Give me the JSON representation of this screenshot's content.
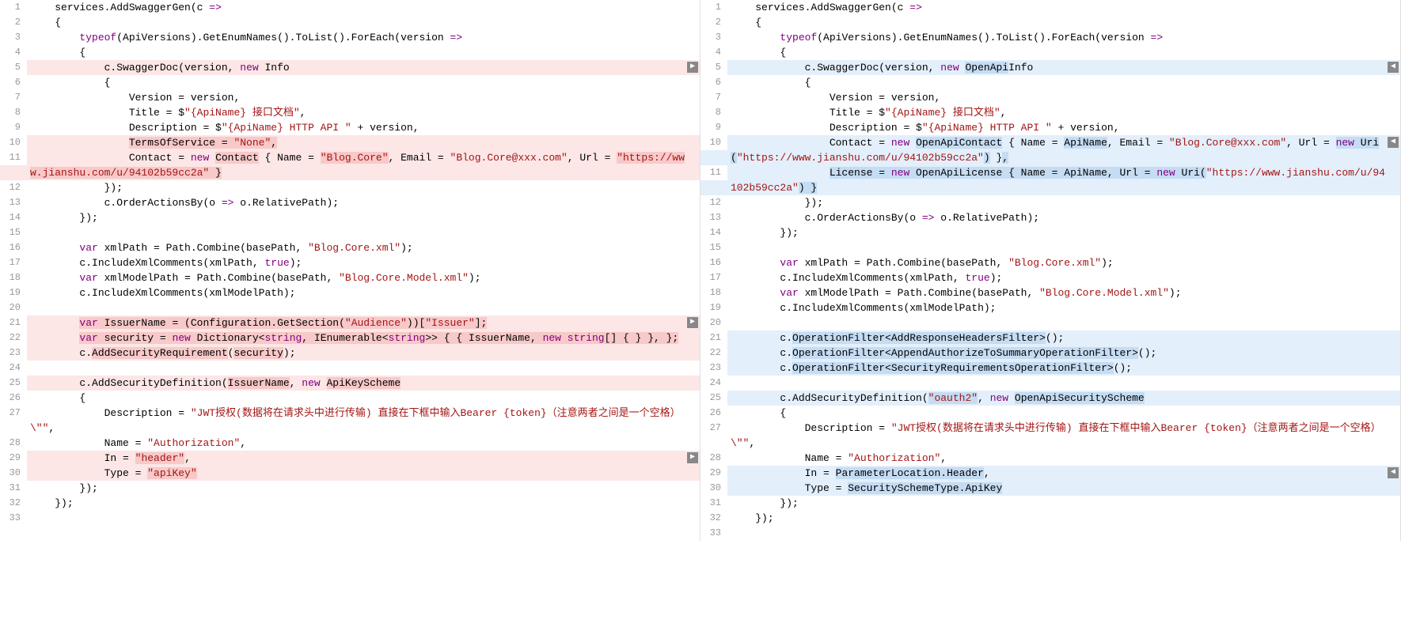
{
  "left": {
    "lines": [
      {
        "num": "1",
        "tokens": [
          [
            "idn",
            "    services.AddSwaggerGen(c "
          ],
          [
            "purple",
            "=>"
          ]
        ]
      },
      {
        "num": "2",
        "tokens": [
          [
            "idn",
            "    {"
          ]
        ]
      },
      {
        "num": "3",
        "tokens": [
          [
            "idn",
            "        "
          ],
          [
            "purple",
            "typeof"
          ],
          [
            "idn",
            "(ApiVersions).GetEnumNames().ToList().ForEach(version "
          ],
          [
            "purple",
            "=>"
          ]
        ]
      },
      {
        "num": "4",
        "tokens": [
          [
            "idn",
            "        {"
          ]
        ]
      },
      {
        "num": "5",
        "bg": "hl-red",
        "marker": true,
        "tokens": [
          [
            "idn",
            "            c.SwaggerDoc(version, "
          ],
          [
            "purple",
            "new"
          ],
          [
            "idn",
            " Info"
          ]
        ]
      },
      {
        "num": "6",
        "tokens": [
          [
            "idn",
            "            {"
          ]
        ]
      },
      {
        "num": "7",
        "tokens": [
          [
            "idn",
            "                Version = version,"
          ]
        ]
      },
      {
        "num": "8",
        "tokens": [
          [
            "idn",
            "                Title = $"
          ],
          [
            "str",
            "\"{ApiName} 接口文档\""
          ],
          [
            "idn",
            ","
          ]
        ]
      },
      {
        "num": "9",
        "tokens": [
          [
            "idn",
            "                Description = $"
          ],
          [
            "str",
            "\"{ApiName} HTTP API \""
          ],
          [
            "idn",
            " + version,"
          ]
        ]
      },
      {
        "num": "10",
        "bg": "hl-red",
        "tokens": [
          [
            "idn",
            "                "
          ],
          [
            "hl-darkred",
            "TermsOfService = "
          ],
          [
            "hl-darkred-str",
            "\"None\""
          ],
          [
            "hl-darkred",
            ","
          ]
        ]
      },
      {
        "num": "11",
        "bg": "hl-red",
        "tokens": [
          [
            "idn",
            "                Contact = "
          ],
          [
            "purple",
            "new"
          ],
          [
            "idn",
            " "
          ],
          [
            "hl-darkred",
            "Contact"
          ],
          [
            "idn",
            " { Name = "
          ],
          [
            "hl-darkred-str",
            "\"Blog.Core\""
          ],
          [
            "idn",
            ", Email = "
          ],
          [
            "str",
            "\"Blog.Core@xxx.com\""
          ],
          [
            "idn",
            ", Url = "
          ],
          [
            "hl-darkred-str",
            "\"https://www.jianshu.com/u/94102b59cc2a\""
          ],
          [
            "hl-darkred",
            " }"
          ]
        ]
      },
      {
        "num": "12",
        "tokens": [
          [
            "idn",
            "            });"
          ]
        ]
      },
      {
        "num": "13",
        "tokens": [
          [
            "idn",
            "            c.OrderActionsBy(o "
          ],
          [
            "purple",
            "=>"
          ],
          [
            "idn",
            " o.RelativePath);"
          ]
        ]
      },
      {
        "num": "14",
        "tokens": [
          [
            "idn",
            "        });"
          ]
        ]
      },
      {
        "num": "15",
        "tokens": [
          [
            "idn",
            ""
          ]
        ]
      },
      {
        "num": "16",
        "tokens": [
          [
            "idn",
            "        "
          ],
          [
            "purple",
            "var"
          ],
          [
            "idn",
            " xmlPath = Path.Combine(basePath, "
          ],
          [
            "str",
            "\"Blog.Core.xml\""
          ],
          [
            "idn",
            ");"
          ]
        ]
      },
      {
        "num": "17",
        "tokens": [
          [
            "idn",
            "        c.IncludeXmlComments(xmlPath, "
          ],
          [
            "purple",
            "true"
          ],
          [
            "idn",
            ");"
          ]
        ]
      },
      {
        "num": "18",
        "tokens": [
          [
            "idn",
            "        "
          ],
          [
            "purple",
            "var"
          ],
          [
            "idn",
            " xmlModelPath = Path.Combine(basePath, "
          ],
          [
            "str",
            "\"Blog.Core.Model.xml\""
          ],
          [
            "idn",
            ");"
          ]
        ]
      },
      {
        "num": "19",
        "tokens": [
          [
            "idn",
            "        c.IncludeXmlComments(xmlModelPath);"
          ]
        ]
      },
      {
        "num": "20",
        "tokens": [
          [
            "idn",
            ""
          ]
        ]
      },
      {
        "num": "21",
        "bg": "hl-red",
        "marker": true,
        "tokens": [
          [
            "idn",
            "        "
          ],
          [
            "hl-darkred-purple",
            "var"
          ],
          [
            "hl-darkred",
            " IssuerName = (Configuration.GetSection("
          ],
          [
            "hl-darkred-str",
            "\"Audience\""
          ],
          [
            "hl-darkred",
            "))["
          ],
          [
            "hl-darkred-str",
            "\"Issuer\""
          ],
          [
            "hl-darkred",
            "];"
          ]
        ]
      },
      {
        "num": "22",
        "bg": "hl-red",
        "tokens": [
          [
            "idn",
            "        "
          ],
          [
            "hl-darkred-purple",
            "var"
          ],
          [
            "hl-darkred",
            " security = "
          ],
          [
            "hl-darkred-purple",
            "new"
          ],
          [
            "hl-darkred",
            " Dictionary<"
          ],
          [
            "hl-darkred-purple",
            "string"
          ],
          [
            "hl-darkred",
            ", IEnumerable<"
          ],
          [
            "hl-darkred-purple",
            "string"
          ],
          [
            "hl-darkred",
            ">> { { IssuerName, "
          ],
          [
            "hl-darkred-purple",
            "new"
          ],
          [
            "hl-darkred",
            " "
          ],
          [
            "hl-darkred-purple",
            "string"
          ],
          [
            "hl-darkred",
            "[] { } }, };"
          ]
        ]
      },
      {
        "num": "23",
        "bg": "hl-red",
        "tokens": [
          [
            "idn",
            "        c."
          ],
          [
            "hl-darkred",
            "AddSecurityRequirement"
          ],
          [
            "idn",
            "("
          ],
          [
            "hl-darkred",
            "security"
          ],
          [
            "idn",
            ");"
          ]
        ]
      },
      {
        "num": "24",
        "tokens": [
          [
            "idn",
            ""
          ]
        ]
      },
      {
        "num": "25",
        "bg": "hl-red",
        "tokens": [
          [
            "idn",
            "        c.AddSecurityDefinition("
          ],
          [
            "hl-darkred",
            "IssuerName"
          ],
          [
            "idn",
            ", "
          ],
          [
            "purple",
            "new"
          ],
          [
            "idn",
            " "
          ],
          [
            "hl-darkred",
            "ApiKeyScheme"
          ]
        ]
      },
      {
        "num": "26",
        "tokens": [
          [
            "idn",
            "        {"
          ]
        ]
      },
      {
        "num": "27",
        "tokens": [
          [
            "idn",
            "            Description = "
          ],
          [
            "str",
            "\"JWT授权(数据将在请求头中进行传输) 直接在下框中输入Bearer {token}（注意两者之间是一个空格）\\\"\""
          ],
          [
            "idn",
            ","
          ]
        ]
      },
      {
        "num": "28",
        "tokens": [
          [
            "idn",
            "            Name = "
          ],
          [
            "str",
            "\"Authorization\""
          ],
          [
            "idn",
            ","
          ]
        ]
      },
      {
        "num": "29",
        "bg": "hl-red",
        "marker": true,
        "tokens": [
          [
            "idn",
            "            In = "
          ],
          [
            "hl-darkred-str",
            "\"header\""
          ],
          [
            "idn",
            ","
          ]
        ]
      },
      {
        "num": "30",
        "bg": "hl-red",
        "tokens": [
          [
            "idn",
            "            Type = "
          ],
          [
            "hl-darkred-str",
            "\"apiKey\""
          ]
        ]
      },
      {
        "num": "31",
        "tokens": [
          [
            "idn",
            "        });"
          ]
        ]
      },
      {
        "num": "32",
        "tokens": [
          [
            "idn",
            "    });"
          ]
        ]
      },
      {
        "num": "33",
        "tokens": [
          [
            "idn",
            ""
          ]
        ]
      }
    ]
  },
  "right": {
    "lines": [
      {
        "num": "1",
        "tokens": [
          [
            "idn",
            "    services.AddSwaggerGen(c "
          ],
          [
            "purple",
            "=>"
          ]
        ]
      },
      {
        "num": "2",
        "tokens": [
          [
            "idn",
            "    {"
          ]
        ]
      },
      {
        "num": "3",
        "tokens": [
          [
            "idn",
            "        "
          ],
          [
            "purple",
            "typeof"
          ],
          [
            "idn",
            "(ApiVersions).GetEnumNames().ToList().ForEach(version "
          ],
          [
            "purple",
            "=>"
          ]
        ]
      },
      {
        "num": "4",
        "tokens": [
          [
            "idn",
            "        {"
          ]
        ]
      },
      {
        "num": "5",
        "bg": "hl-blue",
        "marker": true,
        "tokens": [
          [
            "idn",
            "            c.SwaggerDoc(version, "
          ],
          [
            "purple",
            "new"
          ],
          [
            "idn",
            " "
          ],
          [
            "hl-darkblue",
            "OpenApi"
          ],
          [
            "idn",
            "Info"
          ]
        ]
      },
      {
        "num": "6",
        "tokens": [
          [
            "idn",
            "            {"
          ]
        ]
      },
      {
        "num": "7",
        "tokens": [
          [
            "idn",
            "                Version = version,"
          ]
        ]
      },
      {
        "num": "8",
        "tokens": [
          [
            "idn",
            "                Title = $"
          ],
          [
            "str",
            "\"{ApiName} 接口文档\""
          ],
          [
            "idn",
            ","
          ]
        ]
      },
      {
        "num": "9",
        "tokens": [
          [
            "idn",
            "                Description = $"
          ],
          [
            "str",
            "\"{ApiName} HTTP API \""
          ],
          [
            "idn",
            " + version,"
          ]
        ]
      },
      {
        "num": "10",
        "bg": "hl-blue",
        "marker": true,
        "tokens": [
          [
            "idn",
            "                Contact = "
          ],
          [
            "purple",
            "new"
          ],
          [
            "idn",
            " "
          ],
          [
            "hl-darkblue",
            "OpenApiContact"
          ],
          [
            "idn",
            " { Name = "
          ],
          [
            "hl-darkblue",
            "ApiName"
          ],
          [
            "idn",
            ", Email = "
          ],
          [
            "str",
            "\"Blog.Core@xxx.com\""
          ],
          [
            "idn",
            ", Url = "
          ],
          [
            "hl-darkblue-purple",
            "new"
          ],
          [
            "hl-darkblue",
            " Uri("
          ],
          [
            "str",
            "\"https://www.jianshu.com/u/94102b59cc2a\""
          ],
          [
            "hl-darkblue",
            ")"
          ],
          [
            "idn",
            " }"
          ],
          [
            "hl-darkblue",
            ","
          ]
        ]
      },
      {
        "num": "11",
        "bg": "hl-blue",
        "tokens": [
          [
            "idn",
            "                "
          ],
          [
            "hl-darkblue",
            "License = "
          ],
          [
            "hl-darkblue-purple",
            "new"
          ],
          [
            "hl-darkblue",
            " OpenApiLicense { Name = ApiName, Url = "
          ],
          [
            "hl-darkblue-purple",
            "new"
          ],
          [
            "hl-darkblue",
            " Uri("
          ],
          [
            "str",
            "\"https://www.jianshu.com/u/94102b59cc2a\""
          ],
          [
            "hl-darkblue",
            ") }"
          ]
        ]
      },
      {
        "num": "12",
        "tokens": [
          [
            "idn",
            "            });"
          ]
        ]
      },
      {
        "num": "13",
        "tokens": [
          [
            "idn",
            "            c.OrderActionsBy(o "
          ],
          [
            "purple",
            "=>"
          ],
          [
            "idn",
            " o.RelativePath);"
          ]
        ]
      },
      {
        "num": "14",
        "tokens": [
          [
            "idn",
            "        });"
          ]
        ]
      },
      {
        "num": "15",
        "tokens": [
          [
            "idn",
            ""
          ]
        ]
      },
      {
        "num": "16",
        "tokens": [
          [
            "idn",
            "        "
          ],
          [
            "purple",
            "var"
          ],
          [
            "idn",
            " xmlPath = Path.Combine(basePath, "
          ],
          [
            "str",
            "\"Blog.Core.xml\""
          ],
          [
            "idn",
            ");"
          ]
        ]
      },
      {
        "num": "17",
        "tokens": [
          [
            "idn",
            "        c.IncludeXmlComments(xmlPath, "
          ],
          [
            "purple",
            "true"
          ],
          [
            "idn",
            ");"
          ]
        ]
      },
      {
        "num": "18",
        "tokens": [
          [
            "idn",
            "        "
          ],
          [
            "purple",
            "var"
          ],
          [
            "idn",
            " xmlModelPath = Path.Combine(basePath, "
          ],
          [
            "str",
            "\"Blog.Core.Model.xml\""
          ],
          [
            "idn",
            ");"
          ]
        ]
      },
      {
        "num": "19",
        "tokens": [
          [
            "idn",
            "        c.IncludeXmlComments(xmlModelPath);"
          ]
        ]
      },
      {
        "num": "20",
        "tokens": [
          [
            "idn",
            ""
          ]
        ]
      },
      {
        "num": "21",
        "bg": "hl-blue",
        "tokens": [
          [
            "idn",
            "        c."
          ],
          [
            "hl-darkblue",
            "OperationFilter<AddResponseHeadersFilter>"
          ],
          [
            "idn",
            "();"
          ]
        ]
      },
      {
        "num": "22",
        "bg": "hl-blue",
        "tokens": [
          [
            "idn",
            "        c."
          ],
          [
            "hl-darkblue",
            "OperationFilter<AppendAuthorizeToSummaryOperationFilter>"
          ],
          [
            "idn",
            "();"
          ]
        ]
      },
      {
        "num": "23",
        "bg": "hl-blue",
        "tokens": [
          [
            "idn",
            "        c."
          ],
          [
            "hl-darkblue",
            "OperationFilter<SecurityRequirementsOperationFilter>"
          ],
          [
            "idn",
            "();"
          ]
        ]
      },
      {
        "num": "24",
        "tokens": [
          [
            "idn",
            ""
          ]
        ]
      },
      {
        "num": "25",
        "bg": "hl-blue",
        "tokens": [
          [
            "idn",
            "        c.AddSecurityDefinition("
          ],
          [
            "hl-darkblue-str",
            "\"oauth2\""
          ],
          [
            "idn",
            ", "
          ],
          [
            "purple",
            "new"
          ],
          [
            "idn",
            " "
          ],
          [
            "hl-darkblue",
            "OpenApiSecurityScheme"
          ]
        ]
      },
      {
        "num": "26",
        "tokens": [
          [
            "idn",
            "        {"
          ]
        ]
      },
      {
        "num": "27",
        "tokens": [
          [
            "idn",
            "            Description = "
          ],
          [
            "str",
            "\"JWT授权(数据将在请求头中进行传输) 直接在下框中输入Bearer {token}（注意两者之间是一个空格）\\\"\""
          ],
          [
            "idn",
            ","
          ]
        ]
      },
      {
        "num": "28",
        "tokens": [
          [
            "idn",
            "            Name = "
          ],
          [
            "str",
            "\"Authorization\""
          ],
          [
            "idn",
            ","
          ]
        ]
      },
      {
        "num": "29",
        "bg": "hl-blue",
        "marker": true,
        "tokens": [
          [
            "idn",
            "            In = "
          ],
          [
            "hl-darkblue",
            "ParameterLocation.Header"
          ],
          [
            "idn",
            ","
          ]
        ]
      },
      {
        "num": "30",
        "bg": "hl-blue",
        "tokens": [
          [
            "idn",
            "            Type = "
          ],
          [
            "hl-darkblue",
            "SecuritySchemeType.ApiKey"
          ]
        ]
      },
      {
        "num": "31",
        "tokens": [
          [
            "idn",
            "        });"
          ]
        ]
      },
      {
        "num": "32",
        "tokens": [
          [
            "idn",
            "    });"
          ]
        ]
      },
      {
        "num": "33",
        "tokens": [
          [
            "idn",
            ""
          ]
        ]
      }
    ]
  }
}
